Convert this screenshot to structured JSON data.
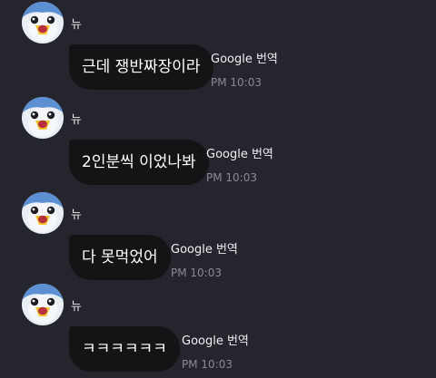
{
  "messages": [
    {
      "sender": "뉴",
      "text": "근데 쟁반짜장이라",
      "translate_label": "Google 번역",
      "time": "PM 10:03"
    },
    {
      "sender": "뉴",
      "text": "2인분씩 이었나봐",
      "translate_label": "Google 번역",
      "time": "PM 10:03"
    },
    {
      "sender": "뉴",
      "text": "다 못먹었어",
      "translate_label": "Google 번역",
      "time": "PM 10:03"
    },
    {
      "sender": "뉴",
      "text": "ㅋㅋㅋㅋㅋㅋ",
      "translate_label": "Google 번역",
      "time": "PM 10:03"
    }
  ],
  "colors": {
    "background": "#25252d",
    "bubble": "#141417",
    "text": "#ffffff",
    "time": "#8a8a95"
  },
  "icons": {
    "avatar": "penguin-avatar-icon"
  }
}
